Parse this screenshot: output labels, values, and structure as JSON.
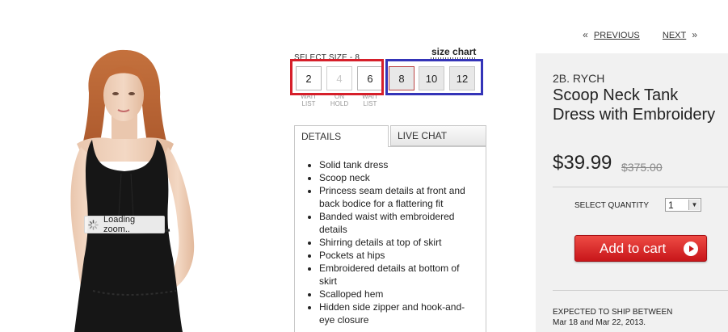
{
  "pager": {
    "previous": "PREVIOUS",
    "next": "NEXT",
    "prev_chevron": "«",
    "next_chevron": "»"
  },
  "image": {
    "loading_text": "Loading zoom..",
    "spinner_icon": "spinner-icon"
  },
  "sizes": {
    "label": "SELECT SIZE - 8",
    "size_chart": "size chart",
    "options": [
      {
        "label": "2",
        "note": "WAIT LIST",
        "state": "waitlist"
      },
      {
        "label": "4",
        "note": "ON HOLD",
        "state": "disabled"
      },
      {
        "label": "6",
        "note": "WAIT LIST",
        "state": "waitlist"
      },
      {
        "label": "8",
        "note": "",
        "state": "selected"
      },
      {
        "label": "10",
        "note": "",
        "state": "available"
      },
      {
        "label": "12",
        "note": "",
        "state": "available"
      }
    ],
    "highlight_colors": {
      "red": "#d61f2a",
      "blue": "#3434b8"
    }
  },
  "tabs": [
    {
      "label": "DETAILS",
      "active": true
    },
    {
      "label": "LIVE CHAT",
      "active": false
    }
  ],
  "details": [
    "Solid tank dress",
    "Scoop neck",
    "Princess seam details at front and back bodice for a flattering fit",
    "Banded waist with embroidered details",
    "Shirring details at top of skirt",
    "Pockets at hips",
    "Embroidered details at bottom of skirt",
    "Scalloped hem",
    "Hidden side zipper and hook-and-eye closure"
  ],
  "product": {
    "brand": "2B. RYCH",
    "name": "Scoop Neck Tank Dress with Embroidery",
    "price": "$39.99",
    "original_price": "$375.00"
  },
  "quantity": {
    "label": "SELECT QUANTITY",
    "value": "1",
    "arrow_icon": "chevron-down-icon"
  },
  "cart": {
    "label": "Add to cart",
    "color": "#d9262b"
  },
  "shipping": {
    "line1": "EXPECTED TO SHIP BETWEEN",
    "line2": "Mar 18 and Mar 22, 2013."
  }
}
